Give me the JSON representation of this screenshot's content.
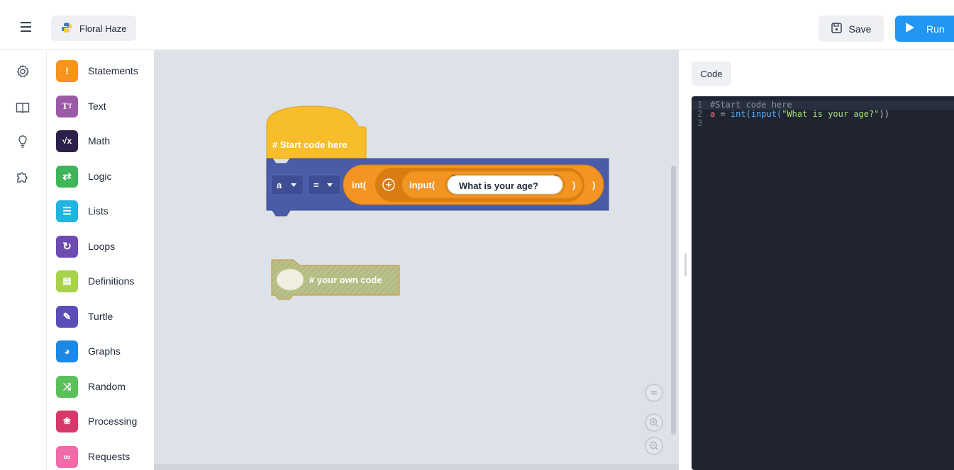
{
  "header": {
    "project_name": "Floral Haze",
    "save_label": "Save",
    "run_label": "Run"
  },
  "rail": {
    "icons": [
      "gear-icon",
      "book-icon",
      "lightbulb-icon",
      "puzzle-icon"
    ]
  },
  "categories": [
    {
      "label": "Statements",
      "icon": "exclamation-icon",
      "color": "#f7941d"
    },
    {
      "label": "Text",
      "icon": "text-icon",
      "color": "#9b5aa6"
    },
    {
      "label": "Math",
      "icon": "sqrt-icon",
      "color": "#2c1f4a"
    },
    {
      "label": "Logic",
      "icon": "arrows-icon",
      "color": "#3fb55a"
    },
    {
      "label": "Lists",
      "icon": "list-icon",
      "color": "#22b3e0"
    },
    {
      "label": "Loops",
      "icon": "loop-icon",
      "color": "#6c4cb0"
    },
    {
      "label": "Definitions",
      "icon": "definition-icon",
      "color": "#a8d24a"
    },
    {
      "label": "Turtle",
      "icon": "pen-icon",
      "color": "#5a4fb8"
    },
    {
      "label": "Graphs",
      "icon": "pie-icon",
      "color": "#1e88e5"
    },
    {
      "label": "Random",
      "icon": "shuffle-icon",
      "color": "#5cc05a"
    },
    {
      "label": "Processing",
      "icon": "palette-icon",
      "color": "#d63a6a"
    },
    {
      "label": "Requests",
      "icon": "link-icon",
      "color": "#f06ba8"
    }
  ],
  "workspace": {
    "start_block": "# Start code here",
    "var_name": "a",
    "operator": "=",
    "int_fn": "int(",
    "input_fn": "input(",
    "prompt_text": "What is your age?",
    "close_paren": ")",
    "comment_block": "# your own code"
  },
  "code": {
    "tab_label": "Code",
    "lines": [
      {
        "num": "1",
        "text": "#Start code here"
      },
      {
        "num": "2",
        "var": "a",
        "op": " = ",
        "fn1": "int(",
        "fn2": "input(",
        "str": "\"What is your age?\"",
        "end": "))"
      },
      {
        "num": "3",
        "text": ""
      }
    ]
  },
  "colors": {
    "accent": "#2196f3",
    "workspace_bg": "#dde1e8",
    "block_blue": "#4a5ba8",
    "block_orange": "#f39423",
    "block_yellow": "#f7bd2b",
    "editor_bg": "#1f2430"
  }
}
